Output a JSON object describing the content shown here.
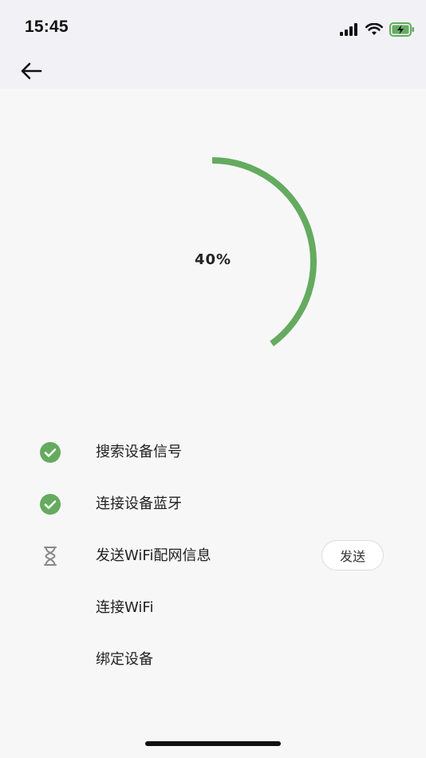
{
  "status_bar": {
    "time": "15:45"
  },
  "nav": {
    "back_icon": "arrow-left-icon"
  },
  "progress": {
    "label": "40%",
    "value": 0.4,
    "color": "#64ab5f"
  },
  "steps": [
    {
      "label": "搜索设备信号",
      "state": "done",
      "icon": "check-circle-icon"
    },
    {
      "label": "连接设备蓝牙",
      "state": "done",
      "icon": "check-circle-icon"
    },
    {
      "label": "发送WiFi配网信息",
      "state": "pending",
      "icon": "hourglass-icon",
      "action_label": "发送"
    },
    {
      "label": "连接WiFi",
      "state": "todo"
    },
    {
      "label": "绑定设备",
      "state": "todo"
    }
  ],
  "colors": {
    "accent": "#64ab5f",
    "background": "#f7f7f8",
    "header": "#f2f2f6"
  }
}
